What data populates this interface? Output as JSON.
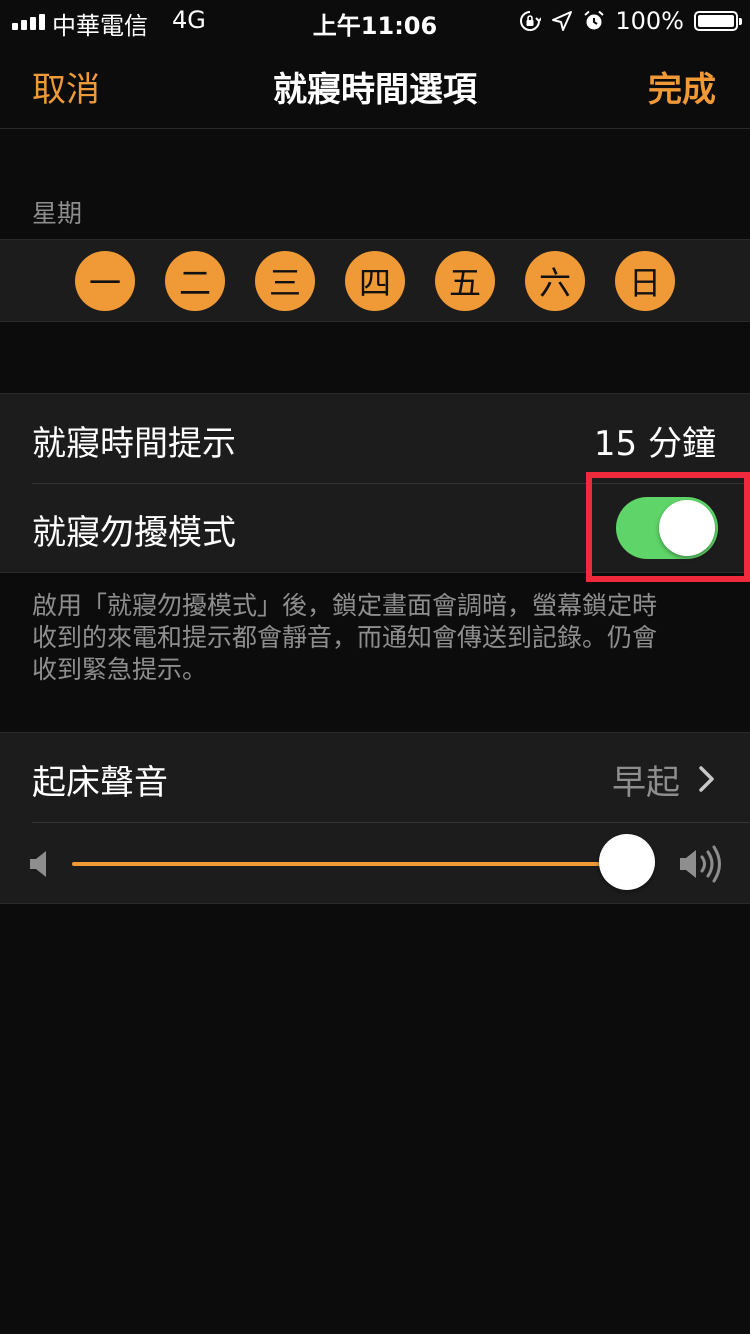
{
  "status_bar": {
    "carrier": "中華電信",
    "network": "4G",
    "time": "上午11:06",
    "battery": "100%",
    "icons": [
      "orientation-lock-icon",
      "location-arrow-icon",
      "alarm-clock-icon"
    ]
  },
  "nav": {
    "cancel": "取消",
    "title": "就寢時間選項",
    "done": "完成"
  },
  "weekday_section": {
    "label": "星期",
    "days": [
      "一",
      "二",
      "三",
      "四",
      "五",
      "六",
      "日"
    ]
  },
  "settings": {
    "reminder_label": "就寢時間提示",
    "reminder_value": "15 分鐘",
    "dnd_label": "就寢勿擾模式",
    "dnd_enabled": true,
    "dnd_footnote_line1": "啟用「就寢勿擾模式」後，鎖定畫面會調暗，螢幕鎖定時",
    "dnd_footnote_line2": "收到的來電和提示都會靜音，而通知會傳送到記錄。仍會",
    "dnd_footnote_line3": "收到緊急提示。"
  },
  "wake_sound": {
    "label": "起床聲音",
    "value": "早起",
    "volume": 1.0
  },
  "colors": {
    "accent": "#f09a37",
    "toggle_on": "#5fd468",
    "highlight": "#ee2a3c",
    "background": "#0c0c0c",
    "cell": "#1c1c1c",
    "secondary_text": "#8e8e8e"
  }
}
